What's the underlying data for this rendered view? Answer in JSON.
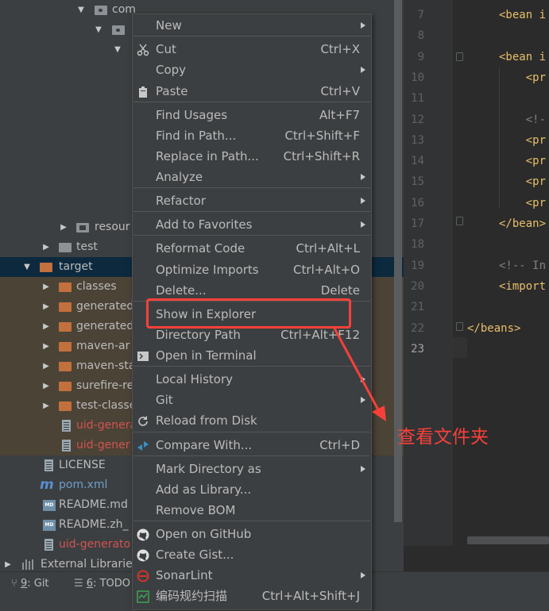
{
  "project_tree": {
    "rows": [
      {
        "label": "com"
      },
      {
        "label": ""
      },
      {
        "label": ""
      },
      {
        "label": "resour"
      },
      {
        "label": "test"
      },
      {
        "label": "target"
      },
      {
        "label": "classes"
      },
      {
        "label": "generated"
      },
      {
        "label": "generated"
      },
      {
        "label": "maven-ar"
      },
      {
        "label": "maven-sta"
      },
      {
        "label": "surefire-re"
      },
      {
        "label": "test-classe"
      },
      {
        "label": "uid-genera"
      },
      {
        "label": "uid-gener"
      },
      {
        "label": "LICENSE"
      },
      {
        "label": "pom.xml"
      },
      {
        "label": "README.md"
      },
      {
        "label": "README.zh_"
      },
      {
        "label": "uid-generato"
      },
      {
        "label": "External Libraries"
      }
    ]
  },
  "bottom_bar": {
    "git_num": "9",
    "git_label": ": Git",
    "todo_num": "6",
    "todo_label": ": TODO"
  },
  "editor": {
    "line_numbers": [
      "7",
      "8",
      "9",
      "10",
      "11",
      "12",
      "13",
      "14",
      "15",
      "16",
      "17",
      "18",
      "19",
      "20",
      "21",
      "22",
      "23"
    ],
    "lines": [
      "<bean i",
      "",
      "<bean i",
      "    <pr",
      "",
      "    <!-",
      "    <pr",
      "    <pr",
      "    <pr",
      "    <pr",
      "</bean>",
      "",
      "<!-- In",
      "<import",
      "",
      "</beans>",
      ""
    ]
  },
  "context_menu": {
    "items": [
      {
        "label": "New",
        "shortcut": ""
      },
      {
        "label": "Cut",
        "shortcut": "Ctrl+X"
      },
      {
        "label": "Copy",
        "shortcut": ""
      },
      {
        "label": "Paste",
        "shortcut": "Ctrl+V"
      },
      {
        "label": "Find Usages",
        "shortcut": "Alt+F7"
      },
      {
        "label": "Find in Path...",
        "shortcut": "Ctrl+Shift+F"
      },
      {
        "label": "Replace in Path...",
        "shortcut": "Ctrl+Shift+R"
      },
      {
        "label": "Analyze",
        "shortcut": ""
      },
      {
        "label": "Refactor",
        "shortcut": ""
      },
      {
        "label": "Add to Favorites",
        "shortcut": ""
      },
      {
        "label": "Reformat Code",
        "shortcut": "Ctrl+Alt+L"
      },
      {
        "label": "Optimize Imports",
        "shortcut": "Ctrl+Alt+O"
      },
      {
        "label": "Delete...",
        "shortcut": "Delete"
      },
      {
        "label": "Show in Explorer",
        "shortcut": ""
      },
      {
        "label": "Directory Path",
        "shortcut": "Ctrl+Alt+F12"
      },
      {
        "label": "Open in Terminal",
        "shortcut": ""
      },
      {
        "label": "Local History",
        "shortcut": ""
      },
      {
        "label": "Git",
        "shortcut": ""
      },
      {
        "label": "Reload from Disk",
        "shortcut": ""
      },
      {
        "label": "Compare With...",
        "shortcut": "Ctrl+D"
      },
      {
        "label": "Mark Directory as",
        "shortcut": ""
      },
      {
        "label": "Add as Library...",
        "shortcut": ""
      },
      {
        "label": "Remove BOM",
        "shortcut": ""
      },
      {
        "label": "Open on GitHub",
        "shortcut": ""
      },
      {
        "label": "Create Gist...",
        "shortcut": ""
      },
      {
        "label": "SonarLint",
        "shortcut": ""
      },
      {
        "label": "编码规约扫描",
        "shortcut": "Ctrl+Alt+Shift+J"
      }
    ]
  },
  "annotation": {
    "text": "查看文件夹",
    "color": "#f5413a"
  }
}
